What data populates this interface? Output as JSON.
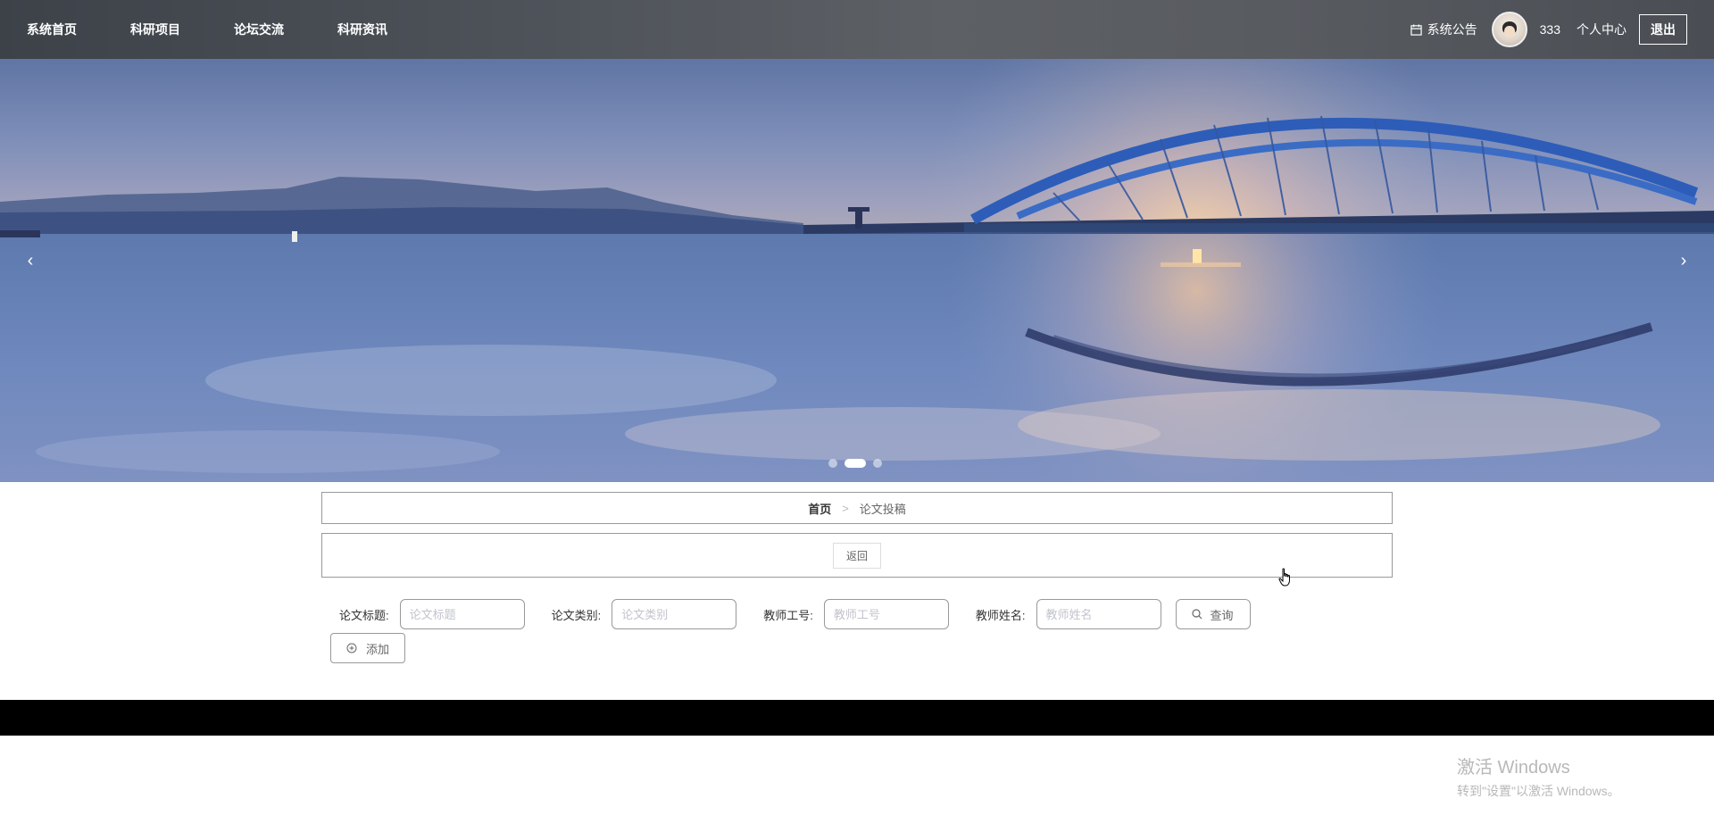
{
  "nav": {
    "items": [
      {
        "label": "系统首页"
      },
      {
        "label": "科研项目"
      },
      {
        "label": "论坛交流"
      },
      {
        "label": "科研资讯"
      }
    ],
    "notice_label": "系统公告",
    "username": "333",
    "personal_center": "个人中心",
    "logout": "退出"
  },
  "banner": {
    "prev_arrow": "‹",
    "next_arrow": "›",
    "slide_count": 3,
    "active_slide": 2
  },
  "breadcrumb": {
    "home": "首页",
    "separator": ">",
    "current": "论文投稿"
  },
  "back_button": "返回",
  "filters": {
    "title_label": "论文标题:",
    "title_placeholder": "论文标题",
    "category_label": "论文类别:",
    "category_placeholder": "论文类别",
    "teacher_id_label": "教师工号:",
    "teacher_id_placeholder": "教师工号",
    "teacher_name_label": "教师姓名:",
    "teacher_name_placeholder": "教师姓名",
    "query_button": "查询"
  },
  "add_button": "添加",
  "watermark": {
    "line1": "激活 Windows",
    "line2": "转到\"设置\"以激活 Windows。"
  }
}
